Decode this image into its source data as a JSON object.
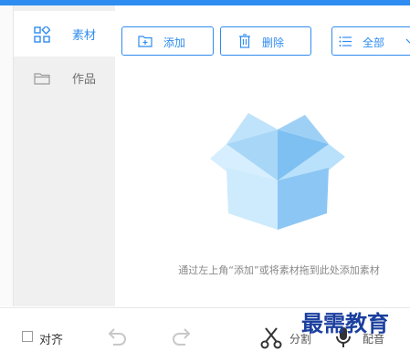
{
  "sidebar": {
    "items": [
      {
        "label": "素材",
        "icon": "grid-icon",
        "active": true
      },
      {
        "label": "作品",
        "icon": "folder-icon",
        "active": false
      }
    ]
  },
  "toolbar": {
    "add_label": "添加",
    "delete_label": "删除",
    "filter_label": "全部"
  },
  "empty_state": {
    "hint": "通过左上角“添加”或将素材拖到此处添加素材",
    "icon": "empty-box-icon"
  },
  "bottom": {
    "align_label": "对齐",
    "align_checked": false,
    "split_label": "分割",
    "dub_label": "配音"
  },
  "watermark": "最需教育",
  "colors": {
    "accent": "#2f8cf0",
    "box_light": "#c8e6fb",
    "box_dark": "#8cc6f4"
  }
}
